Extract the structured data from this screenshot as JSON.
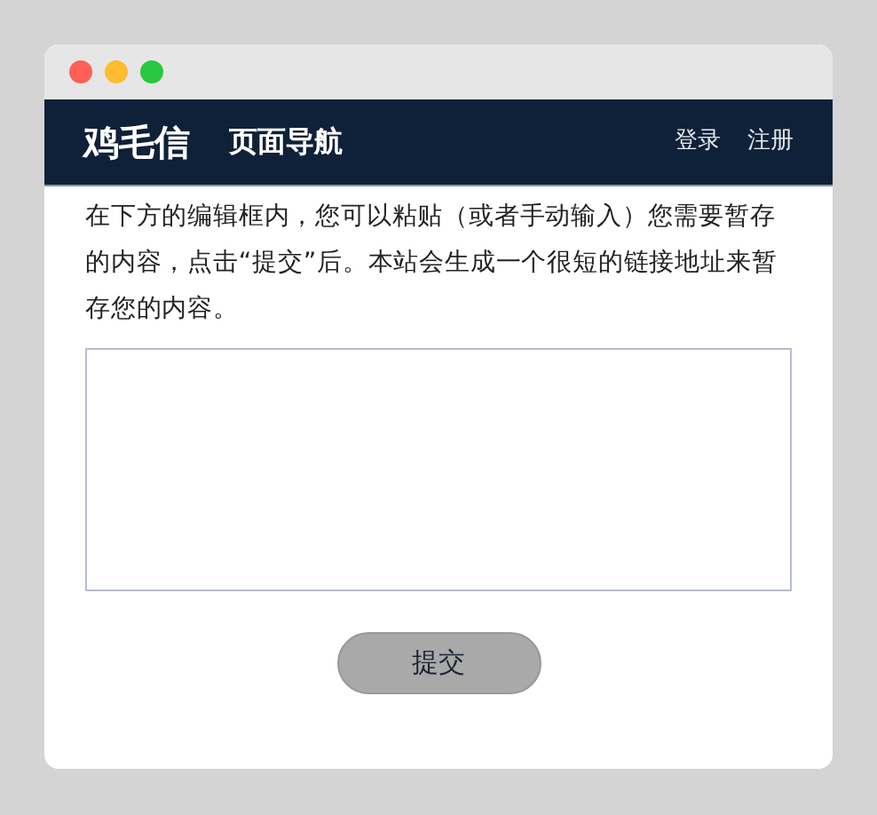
{
  "window": {
    "controls": [
      {
        "color": "#fe5f57"
      },
      {
        "color": "#febc2e"
      },
      {
        "color": "#28c840"
      }
    ]
  },
  "navbar": {
    "brand": "鸡毛信",
    "menu": "页面导航",
    "links": [
      "登录",
      "注册"
    ]
  },
  "intro": "在下方的编辑框内，您可以粘贴（或者手动输入）您需要暂存的内容，点击“提交”后。本站会生成一个很短的链接地址来暂存您的内容。",
  "submit_button": "提交"
}
